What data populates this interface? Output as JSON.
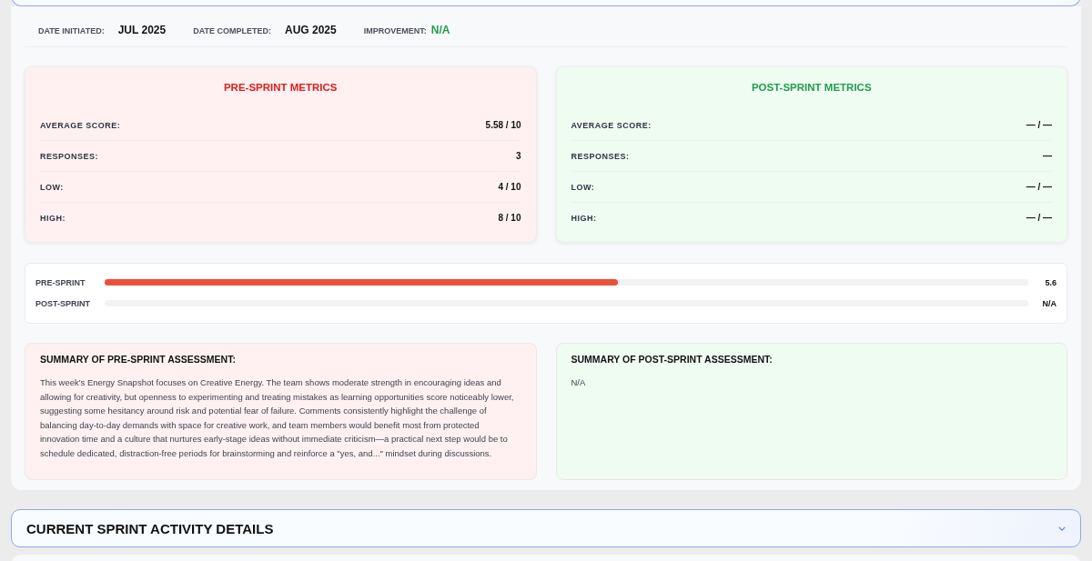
{
  "info": [
    {
      "label": "DATE INITIATED:",
      "value": "JUL 2025",
      "kind": "plain"
    },
    {
      "label": "DATE COMPLETED:",
      "value": "AUG 2025",
      "kind": "plain"
    },
    {
      "label": "IMPROVEMENT:",
      "value": "N/A",
      "kind": "highlight"
    }
  ],
  "metric_cards": [
    {
      "title": "PRE-SPRINT METRICS",
      "kind": "pre",
      "rows": [
        {
          "label": "AVERAGE SCORE:",
          "value": "5.58 / 10"
        },
        {
          "label": "RESPONSES:",
          "value": "3"
        },
        {
          "label": "LOW:",
          "value": "4 / 10"
        },
        {
          "label": "HIGH:",
          "value": "8 / 10"
        }
      ]
    },
    {
      "title": "POST-SPRINT METRICS",
      "kind": "post",
      "rows": [
        {
          "label": "AVERAGE SCORE:",
          "value": "— / —"
        },
        {
          "label": "RESPONSES:",
          "value": "—"
        },
        {
          "label": "LOW:",
          "value": "— / —"
        },
        {
          "label": "HIGH:",
          "value": "— / —"
        }
      ]
    }
  ],
  "bars": [
    {
      "label": "PRE-SPRINT",
      "level": 0.556,
      "reading": "5.6"
    },
    {
      "label": "POST-SPRINT",
      "level": 0,
      "reading": "N/A"
    }
  ],
  "summaries": [
    {
      "title": "SUMMARY OF PRE-SPRINT ASSESSMENT:",
      "kind": "pre",
      "text": "This week's Energy Snapshot focuses on Creative Energy. The team shows moderate strength in encouraging ideas and allowing for creativity, but openness to experimenting and treating mistakes as learning opportunities score noticeably lower, suggesting some hesitancy around risk and potential fear of failure. Comments consistently highlight the challenge of balancing day-to-day demands with space for creative work, and team members would benefit most from protected innovation time and a culture that nurtures early-stage ideas without immediate criticism—a practical next step would be to schedule dedicated, distraction-free periods for brainstorming and reinforce a \"yes, and...\" mindset during discussions."
    },
    {
      "title": "SUMMARY OF POST-SPRINT ASSESSMENT:",
      "kind": "post",
      "text": "N/A"
    }
  ],
  "section": {
    "title": "CURRENT SPRINT ACTIVITY DETAILS",
    "expanded": false
  }
}
